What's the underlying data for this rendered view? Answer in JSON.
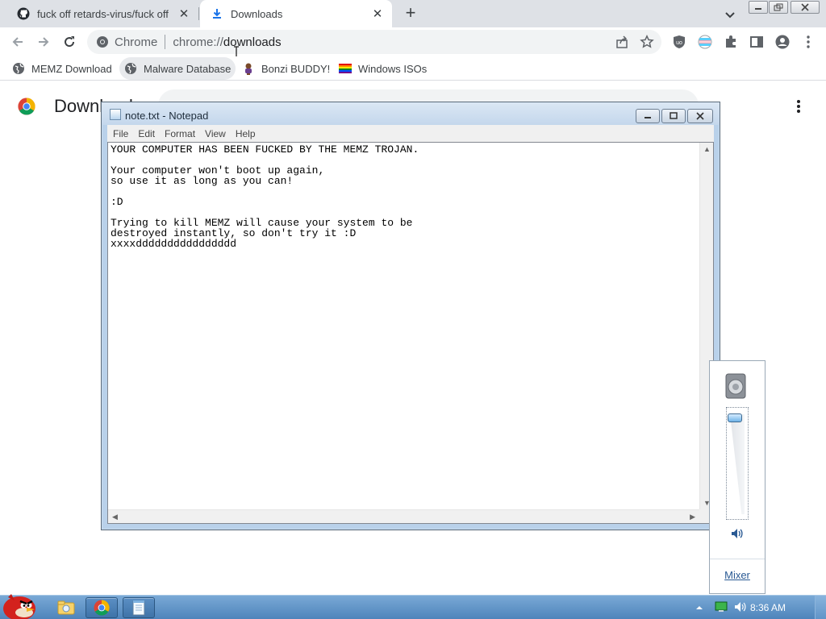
{
  "browser": {
    "tabs": [
      {
        "title": "fuck off retards-virus/fuck off",
        "icon": "github-icon",
        "active": false
      },
      {
        "title": "Downloads",
        "icon": "download-icon",
        "active": true
      }
    ],
    "omnibox": {
      "chip": "Chrome",
      "url_scheme": "chrome://",
      "url_path": "downloads"
    },
    "bookmarks": [
      {
        "label": "MEMZ Download",
        "icon": "globe-icon"
      },
      {
        "label": "Malware Database",
        "icon": "globe-icon"
      },
      {
        "label": "Bonzi BUDDY!",
        "icon": "bonzi-icon"
      },
      {
        "label": "Windows ISOs",
        "icon": "windows-flag-icon"
      }
    ]
  },
  "page": {
    "title": "Downloads"
  },
  "notepad": {
    "title": "note.txt - Notepad",
    "menus": [
      "File",
      "Edit",
      "Format",
      "View",
      "Help"
    ],
    "content": "YOUR COMPUTER HAS BEEN FUCKED BY THE MEMZ TROJAN.\n\nYour computer won't boot up again,\nso use it as long as you can!\n\n:D\n\nTrying to kill MEMZ will cause your system to be\ndestroyed instantly, so don't try it :D\nxxxxdddddddddddddddd"
  },
  "volume": {
    "mixer_label": "Mixer",
    "level_percent": 100
  },
  "taskbar": {
    "clock": "8:36 AM"
  },
  "colors": {
    "chrome_frame": "#dee1e6",
    "taskbar": "#5b8fc4",
    "link": "#2a5a94"
  }
}
